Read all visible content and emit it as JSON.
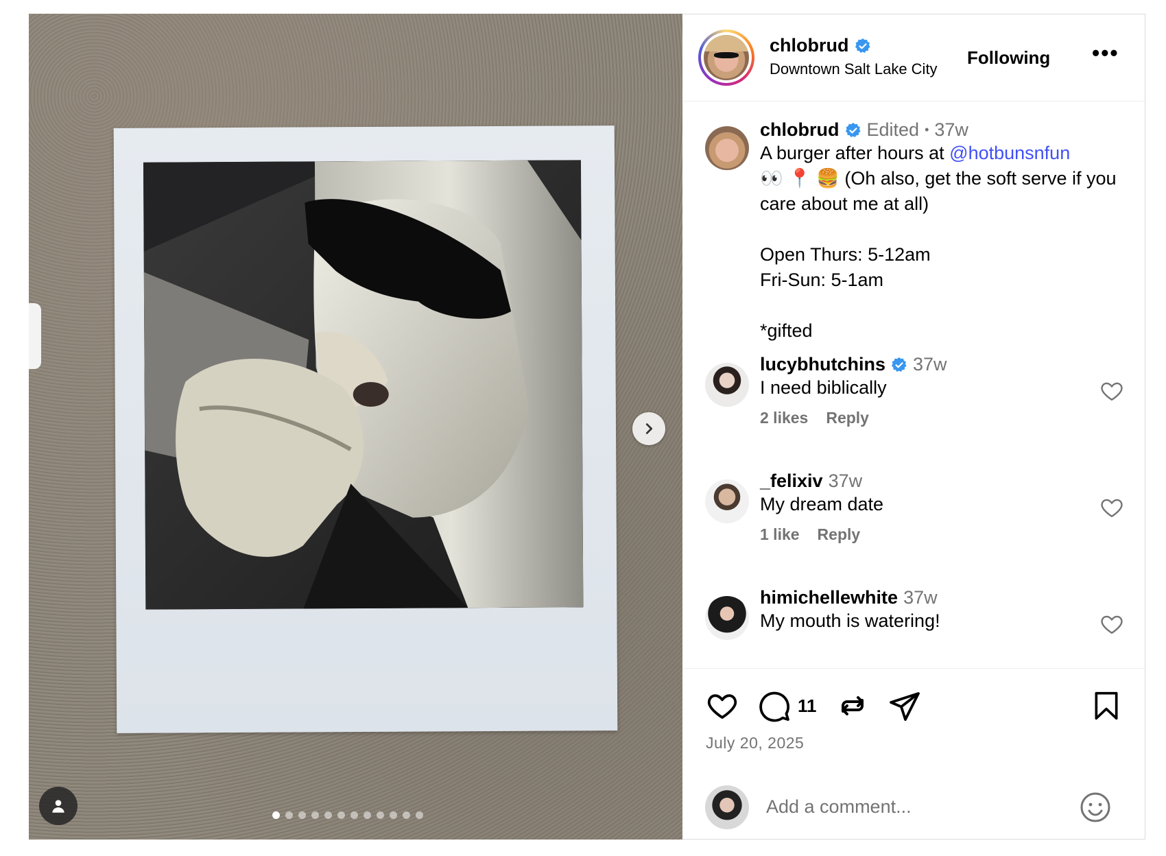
{
  "post": {
    "username": "chlobrud",
    "location": "Downtown Salt Lake City",
    "follow_label": "Following",
    "more_label": "•••"
  },
  "caption": {
    "username": "chlobrud",
    "edited": "Edited",
    "sep": "•",
    "time": "37w",
    "line1_prefix": "A burger after hours at ",
    "mention": "@hotbunsnfun",
    "line2": "👀 📍 🍔 (Oh also, get the soft serve if you care about me at all)",
    "line3": "Open Thurs: 5-12am",
    "line4": "Fri-Sun: 5-1am",
    "line5": "*gifted"
  },
  "comments": [
    {
      "username": "lucybhutchins",
      "verified": true,
      "time": "37w",
      "text": "I need biblically",
      "likes": "2 likes",
      "reply": "Reply"
    },
    {
      "username": "_felixiv",
      "verified": false,
      "time": "37w",
      "text": "My dream date",
      "likes": "1 like",
      "reply": "Reply"
    },
    {
      "username": "himichellewhite",
      "verified": false,
      "time": "37w",
      "text": "My mouth is watering!"
    }
  ],
  "actions": {
    "comment_count": "11",
    "date": "July 20, 2025"
  },
  "add_comment": {
    "placeholder": "Add a comment..."
  },
  "carousel": {
    "total": 12,
    "active_index": 0
  },
  "colors": {
    "verified": "#3897f0",
    "mention": "#4150f7",
    "muted": "#737373"
  }
}
